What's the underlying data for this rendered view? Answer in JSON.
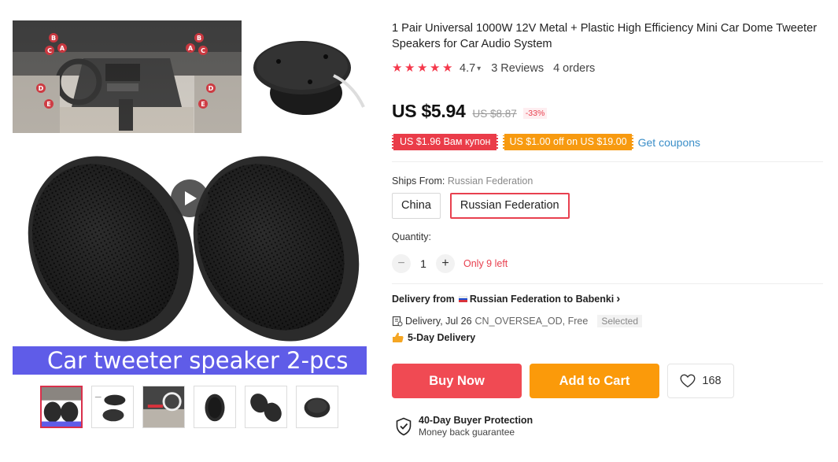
{
  "product": {
    "title": "1 Pair Universal 1000W 12V Metal + Plastic High Efficiency Mini Car Dome Tweeter Speakers for Car Audio System"
  },
  "rating": {
    "stars": 5,
    "value": "4.7",
    "reviews": "3 Reviews",
    "orders": "4 orders"
  },
  "price": {
    "current": "US $5.94",
    "original": "US $8.87",
    "discount": "-33%"
  },
  "coupons": {
    "store_coupon": "US $1.96 Вам купон",
    "select_coupon": "US $1.00 off on US $19.00",
    "get_coupons": "Get coupons"
  },
  "shipping": {
    "label": "Ships From:",
    "selected_value": "Russian Federation",
    "options": [
      "China",
      "Russian Federation"
    ]
  },
  "quantity": {
    "label": "Quantity:",
    "minus": "−",
    "value": "1",
    "plus": "+",
    "stock": "Only 9 left"
  },
  "delivery": {
    "from_prefix": "Delivery from",
    "from_text": "Russian Federation to Babenki",
    "chevron": "›",
    "line": "Delivery, Jul 26",
    "method": "CN_OVERSEA_OD, Free",
    "selected": "Selected",
    "fast": "5-Day Delivery"
  },
  "actions": {
    "buy_now": "Buy Now",
    "add_to_cart": "Add to Cart",
    "wishlist_count": "168"
  },
  "protection": {
    "title": "40-Day Buyer Protection",
    "subtitle": "Money back guarantee"
  },
  "gallery": {
    "banner_text": "Car tweeter speaker 2-pcs",
    "dash_markers": [
      "B",
      "A",
      "C",
      "D",
      "E",
      "B",
      "A",
      "C",
      "D",
      "E"
    ],
    "thumbnail_count": 6
  },
  "colors": {
    "accent_red": "#f04a53",
    "accent_orange": "#fb9a0a",
    "link_blue": "#3a8ec8",
    "banner_purple": "#5f5ce8"
  },
  "icons": {
    "rating_chevron": "▾",
    "star": "★"
  }
}
